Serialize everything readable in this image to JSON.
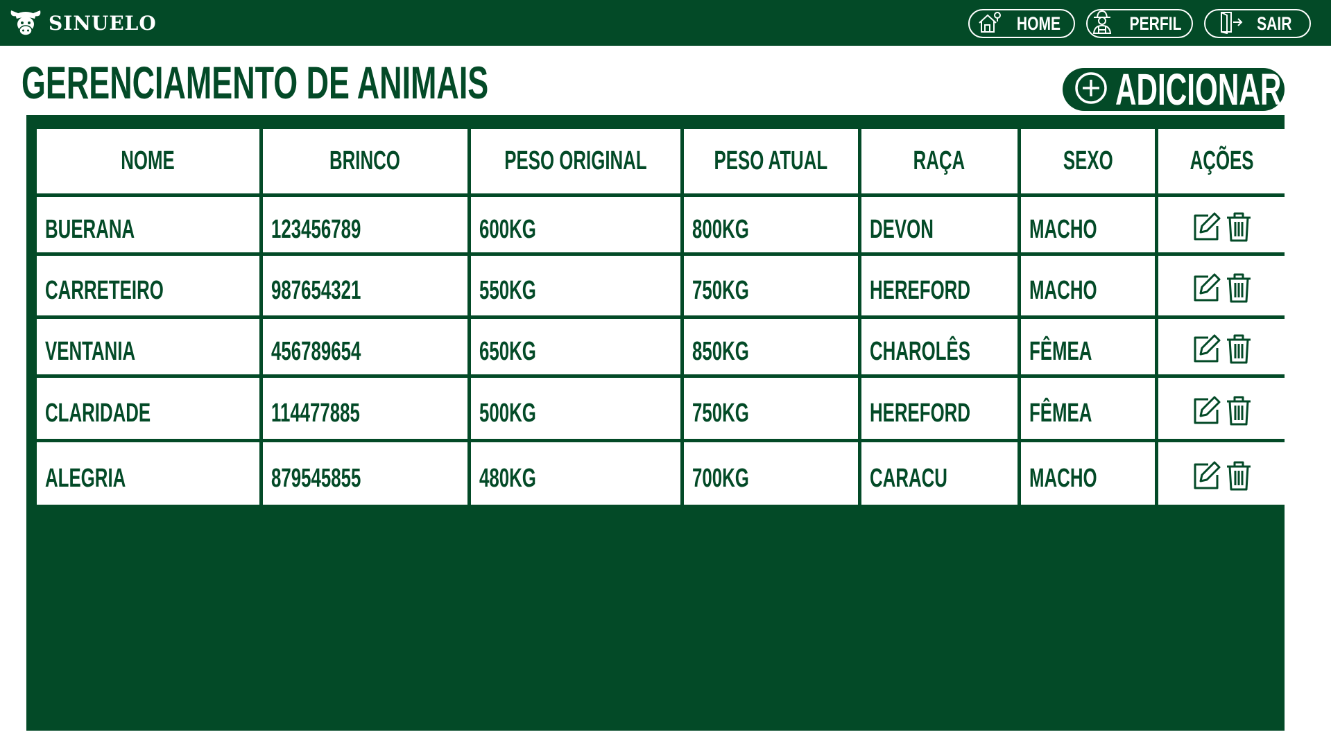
{
  "app": {
    "name": "SINUELO",
    "logo_icon": "cow-head-icon"
  },
  "nav": {
    "home_label": "HOME",
    "perfil_label": "PERFIL",
    "sair_label": "SAIR"
  },
  "page": {
    "title": "GERENCIAMENTO DE ANIMAIS",
    "add_label": "ADICIONAR"
  },
  "table": {
    "columns": [
      "NOME",
      "BRINCO",
      "PESO ORIGINAL",
      "PESO ATUAL",
      "RAÇA",
      "SEXO",
      "AÇÕES"
    ],
    "rows": [
      [
        "BUERANA",
        "123456789",
        "600KG",
        "800KG",
        "DEVON",
        "MACHO"
      ],
      [
        "CARRETEIRO",
        "987654321",
        "550KG",
        "750KG",
        "HEREFORD",
        "MACHO"
      ],
      [
        "VENTANIA",
        "456789654",
        "650KG",
        "850KG",
        "CHAROLÊS",
        "FÊMEA"
      ],
      [
        "CLARIDADE",
        "114477885",
        "500KG",
        "750KG",
        "HEREFORD",
        "FÊMEA"
      ],
      [
        "ALEGRIA",
        "879545855",
        "480KG",
        "700KG",
        "CARACU",
        "MACHO"
      ]
    ]
  },
  "colors": {
    "primary": "#034a27",
    "background": "#ffffff"
  }
}
